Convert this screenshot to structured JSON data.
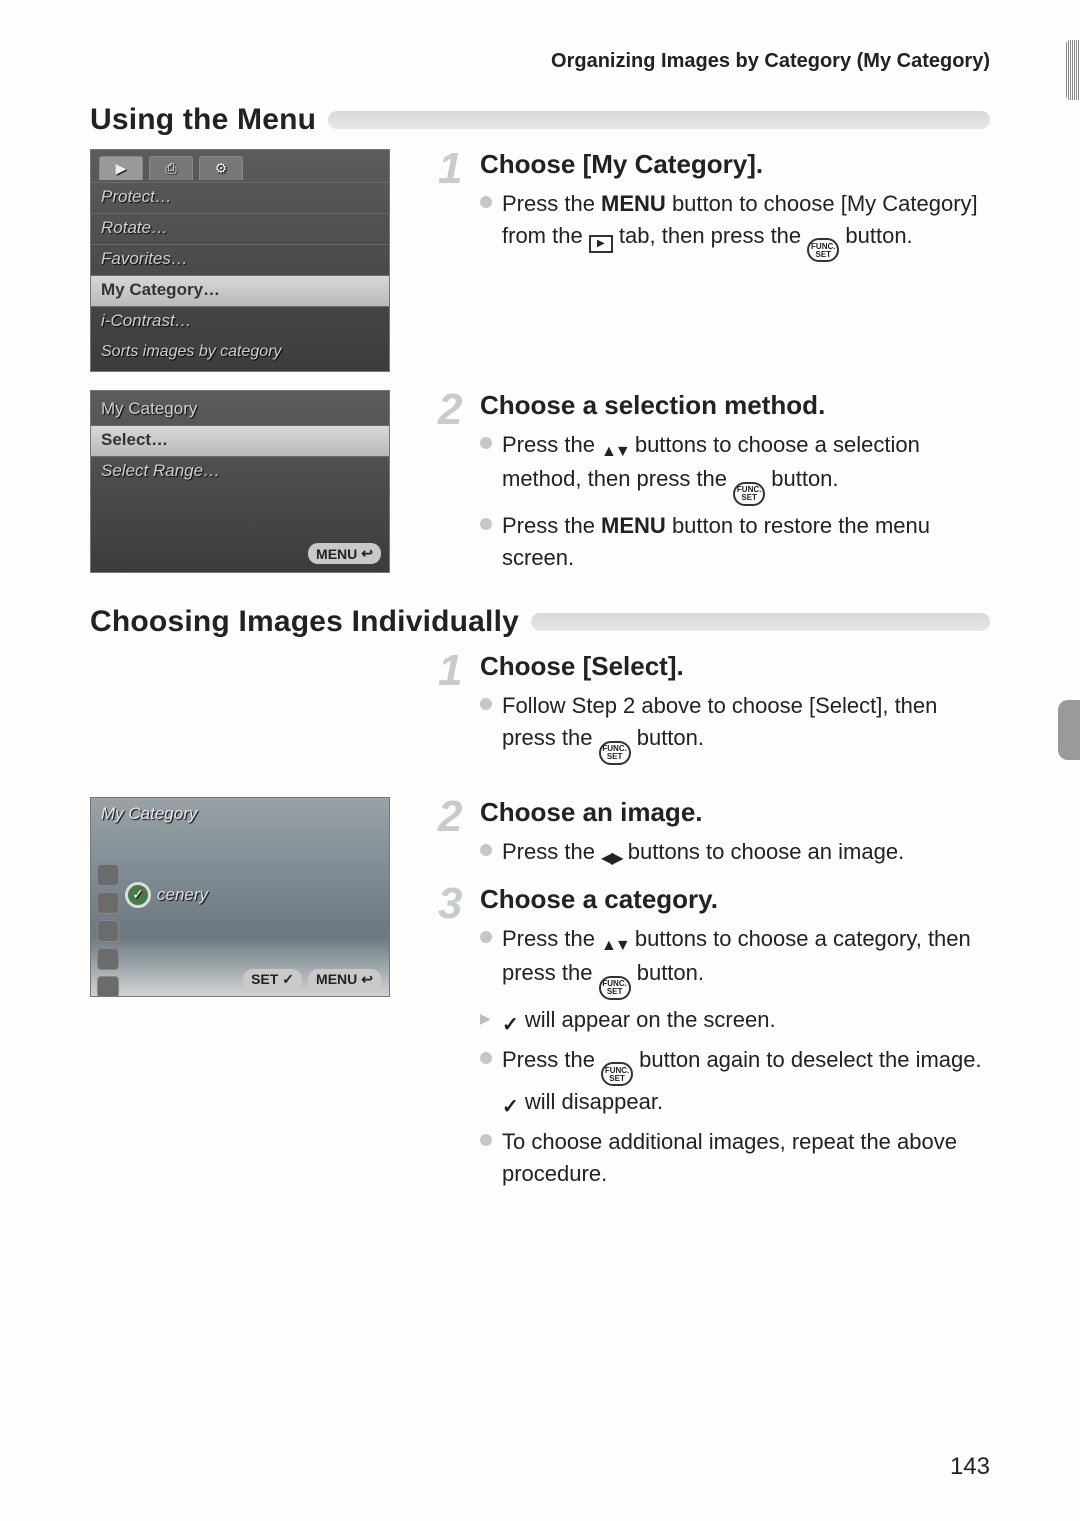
{
  "header": "Organizing Images by Category (My Category)",
  "page_number": "143",
  "section1": {
    "title": "Using the Menu",
    "cam1": {
      "tab1": "▶",
      "tab2": "⎙",
      "tab3": "⚙",
      "rows": [
        "Protect…",
        "Rotate…",
        "Favorites…",
        "My Category…",
        "i-Contrast…"
      ],
      "help": "Sorts images by category"
    },
    "step1": {
      "num": "1",
      "title": "Choose [My Category].",
      "b1a": "Press the ",
      "b1_menu": "MENU",
      "b1b": " button to choose [My Category] from the ",
      "b1c": " tab, then press the ",
      "b1d": " button."
    },
    "cam2": {
      "title": "My Category",
      "rows": [
        "Select…",
        "Select Range…"
      ],
      "btn": "MENU"
    },
    "step2": {
      "num": "2",
      "title": "Choose a selection method.",
      "b1a": "Press the ",
      "b1b": " buttons to choose a selection method, then press the ",
      "b1c": " button.",
      "b2a": "Press the ",
      "b2_menu": "MENU",
      "b2b": " button to restore the menu screen."
    }
  },
  "section2": {
    "title": "Choosing Images Individually",
    "step1": {
      "num": "1",
      "title": "Choose [Select].",
      "b1a": "Follow Step 2 above to choose [Select], then press the ",
      "b1b": " button."
    },
    "cam3": {
      "title": "My Category",
      "scenery": "cenery",
      "btn_set": "SET",
      "btn_menu": "MENU"
    },
    "step2": {
      "num": "2",
      "title": "Choose an image.",
      "b1a": "Press the ",
      "b1b": " buttons to choose an image."
    },
    "step3": {
      "num": "3",
      "title": "Choose a category.",
      "b1a": "Press the ",
      "b1b": " buttons to choose a category, then press the ",
      "b1c": " button.",
      "b2b": " will appear on the screen.",
      "b3a": "Press the ",
      "b3b": " button again to deselect the image. ",
      "b3c": " will disappear.",
      "b4": "To choose additional images, repeat the above procedure."
    }
  },
  "func_label_top": "FUNC.",
  "func_label_bot": "SET"
}
